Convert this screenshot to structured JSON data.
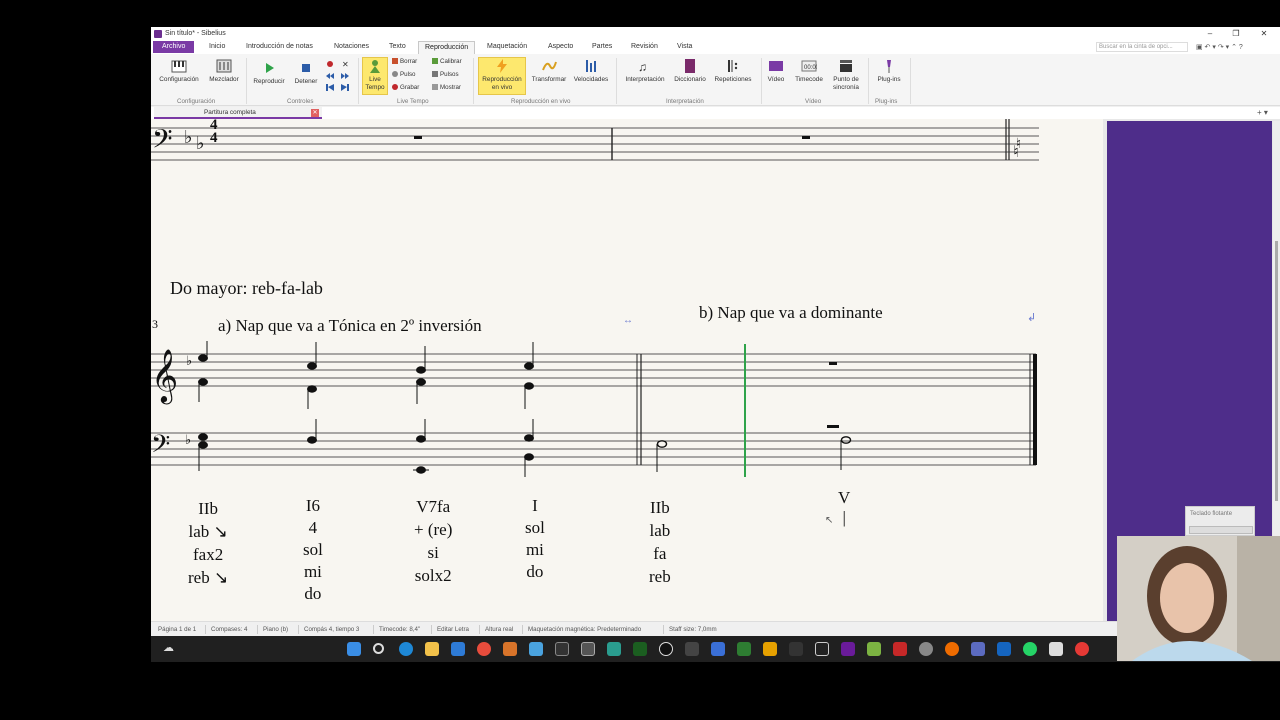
{
  "window": {
    "title": "Sin título* - Sibelius",
    "minimize": "–",
    "restore": "❐",
    "close": "✕"
  },
  "menu": {
    "tabs": [
      "Archivo",
      "Inicio",
      "Introducción de notas",
      "Notaciones",
      "Texto",
      "Reproducción",
      "Maquetación",
      "Aspecto",
      "Partes",
      "Revisión",
      "Vista"
    ],
    "active": "Reproducción",
    "search_placeholder": "Buscar en la cinta de opci..."
  },
  "ribbon": {
    "config_group": {
      "label": "Configuración",
      "buttons": [
        "Configuración",
        "Mezclador"
      ]
    },
    "controls_group": {
      "label": "Controles",
      "buttons": [
        "Reproducir",
        "Detener"
      ]
    },
    "livetempo_group": {
      "label": "Live Tempo",
      "main": "Live Tempo",
      "small": [
        "Borrar",
        "Pulso",
        "Grabar",
        "Calibrar",
        "Pulsos",
        "Mostrar"
      ]
    },
    "live_group": {
      "label": "Reproducción en vivo",
      "buttons": [
        "Reproducción en vivo",
        "Transformar",
        "Velocidades"
      ]
    },
    "interp_group": {
      "label": "Interpretación",
      "buttons": [
        "Interpretación",
        "Diccionario",
        "Repeticiones"
      ]
    },
    "video_group": {
      "label": "Vídeo",
      "buttons": [
        "Vídeo",
        "Timecode",
        "Punto de sincronía"
      ]
    },
    "plugins_group": {
      "label": "Plug-ins",
      "buttons": [
        "Plug-ins"
      ]
    }
  },
  "document_tab": {
    "label": "Partitura completa",
    "close": "✕"
  },
  "score": {
    "key_label": "Do mayor: reb-fa-lab",
    "section_a": "a) Nap que va a Tónica en 2º inversión",
    "section_b": "b) Nap que va a dominante",
    "measure_number": "3",
    "time_sig": [
      "4",
      "4"
    ],
    "analysis": [
      {
        "lines": [
          "IIb",
          "lab ↘",
          "fax2",
          "reb ↘"
        ]
      },
      {
        "lines": [
          "I6",
          "4",
          "sol",
          "mi",
          "do"
        ]
      },
      {
        "lines": [
          "V7fa",
          "+ (re)",
          "si",
          "solx2"
        ]
      },
      {
        "lines": [
          "I",
          "sol",
          "mi",
          "do"
        ]
      },
      {
        "lines": [
          "IIb",
          "lab",
          "fa",
          "reb"
        ]
      },
      {
        "lines": [
          "V",
          "|"
        ]
      }
    ]
  },
  "statusbar": [
    "Página 1 de 1",
    "Compases: 4",
    "Piano (b)",
    "Compás 4, tiempo 3",
    "Timecode: 8,4\"",
    "Editar Letra",
    "Altura real",
    "Maquetación magnética: Predeterminado",
    "Staff size: 7,0mm"
  ],
  "floating_keyboard": {
    "label": "Teclado flotante"
  },
  "colors": {
    "accent": "#7a3aa5",
    "panel": "#4e2d8a",
    "live_tempo": "#fde86e"
  }
}
